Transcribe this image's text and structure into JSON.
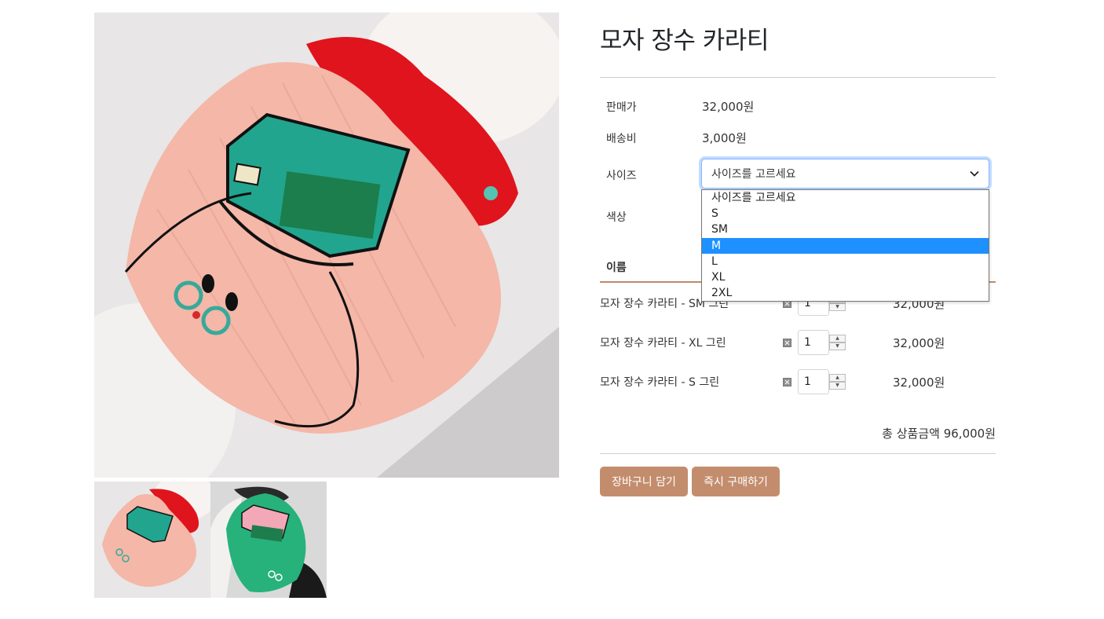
{
  "product": {
    "title": "모자 장수 카라티"
  },
  "info": {
    "price_label": "판매가",
    "price_value": "32,000원",
    "shipping_label": "배송비",
    "shipping_value": "3,000원",
    "size_label": "사이즈",
    "color_label": "색상"
  },
  "size_select": {
    "current": "사이즈를 고르세요",
    "options": [
      "사이즈를 고르세요",
      "S",
      "SM",
      "M",
      "L",
      "XL",
      "2XL"
    ],
    "highlighted": "M"
  },
  "options_table": {
    "header_name": "이름",
    "rows": [
      {
        "name": "모자 장수 카라티 - SM 그린",
        "qty": "1",
        "price": "32,000원"
      },
      {
        "name": "모자 장수 카라티 - XL 그린",
        "qty": "1",
        "price": "32,000원"
      },
      {
        "name": "모자 장수 카라티 - S 그린",
        "qty": "1",
        "price": "32,000원"
      }
    ]
  },
  "summary": {
    "total": "총 상품금액 96,000원"
  },
  "actions": {
    "cart_label": "장바구니 담기",
    "buy_label": "즉시 구매하기"
  },
  "colors": {
    "accent": "#c38d6d",
    "highlight": "#1e90ff"
  },
  "icons": [
    "chevron-down-icon",
    "remove-icon",
    "spin-up-icon",
    "spin-down-icon"
  ]
}
